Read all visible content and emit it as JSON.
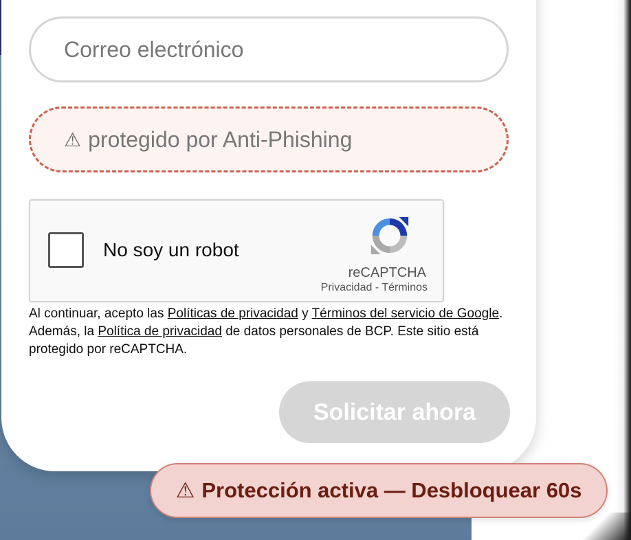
{
  "form": {
    "email_placeholder": "Correo electrónico",
    "phishing_field": {
      "icon": "warning-icon",
      "text": "protegido por Anti-Phishing"
    }
  },
  "recaptcha": {
    "checkbox_label": "No soy un robot",
    "brand": "reCAPTCHA",
    "privacy_link": "Privacidad",
    "separator": "-",
    "terms_link": "Términos"
  },
  "legal": {
    "part1": "Al continuar, acepto las ",
    "link1": "Políticas de privacidad",
    "part2": " y ",
    "link2": "Términos del servicio de Google",
    "part3": ". Además, la ",
    "link3": "Política de privacidad",
    "part4": " de datos personales de BCP. Este sitio está protegido por reCAPTCHA."
  },
  "submit_label": "Solicitar ahora",
  "toast": {
    "icon": "warning-icon",
    "text": "Protección activa — Desbloquear 60s"
  },
  "colors": {
    "phishing_border": "#c9634e",
    "toast_bg": "#f3d3cf",
    "toast_text": "#6a1e12",
    "submit_disabled": "#d6d6d6"
  }
}
